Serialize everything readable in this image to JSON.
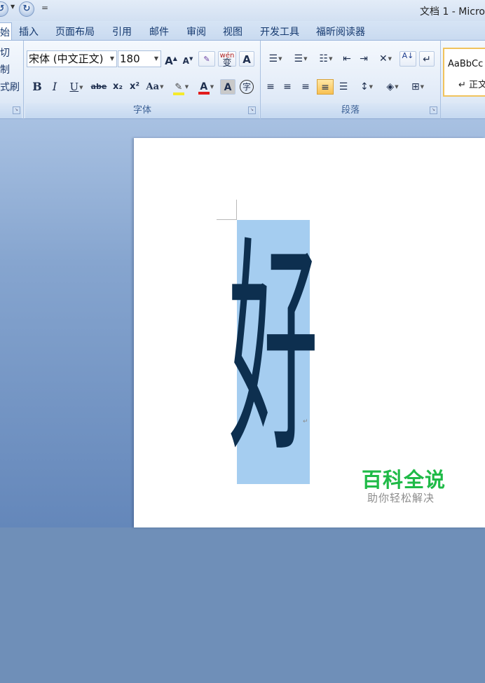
{
  "titlebar": {
    "undo_icon": "undo-icon",
    "redo_glyph": "↻",
    "customize_glyph": "=",
    "doc_title": "文档 1 - Micro"
  },
  "tabs": [
    {
      "label": "始",
      "active": true
    },
    {
      "label": "插入"
    },
    {
      "label": "页面布局"
    },
    {
      "label": "引用"
    },
    {
      "label": "邮件"
    },
    {
      "label": "审阅"
    },
    {
      "label": "视图"
    },
    {
      "label": "开发工具"
    },
    {
      "label": "福昕阅读器"
    }
  ],
  "clipboard": {
    "cut": "切",
    "copy": "制",
    "format_painter": "式刷"
  },
  "font_group": {
    "font_name": "宋体 (中文正文)",
    "font_size": "180",
    "label": "字体",
    "bold": "B",
    "italic": "I",
    "underline": "U",
    "strike": "abe",
    "subscript": "x₂",
    "superscript": "x²",
    "change_case": "Aa",
    "font_color_letter": "A",
    "char_shading": "A",
    "grow": "A",
    "shrink": "A",
    "phonetic": "wén",
    "char_border": "A",
    "enclose": "字"
  },
  "paragraph_group": {
    "label": "段落",
    "sort": "A↓"
  },
  "styles": {
    "preview": "AaBbCc",
    "name": "↵ 正文"
  },
  "document": {
    "character": "好",
    "paragraph_mark": "↵"
  },
  "watermark": {
    "title": "百科全说",
    "subtitle": "助你轻松解决"
  },
  "colors": {
    "highlight": "#f5ea2c",
    "font_color": "#e21c1c",
    "selection": "#a5cdf0",
    "watermark_green": "#1fba47"
  }
}
